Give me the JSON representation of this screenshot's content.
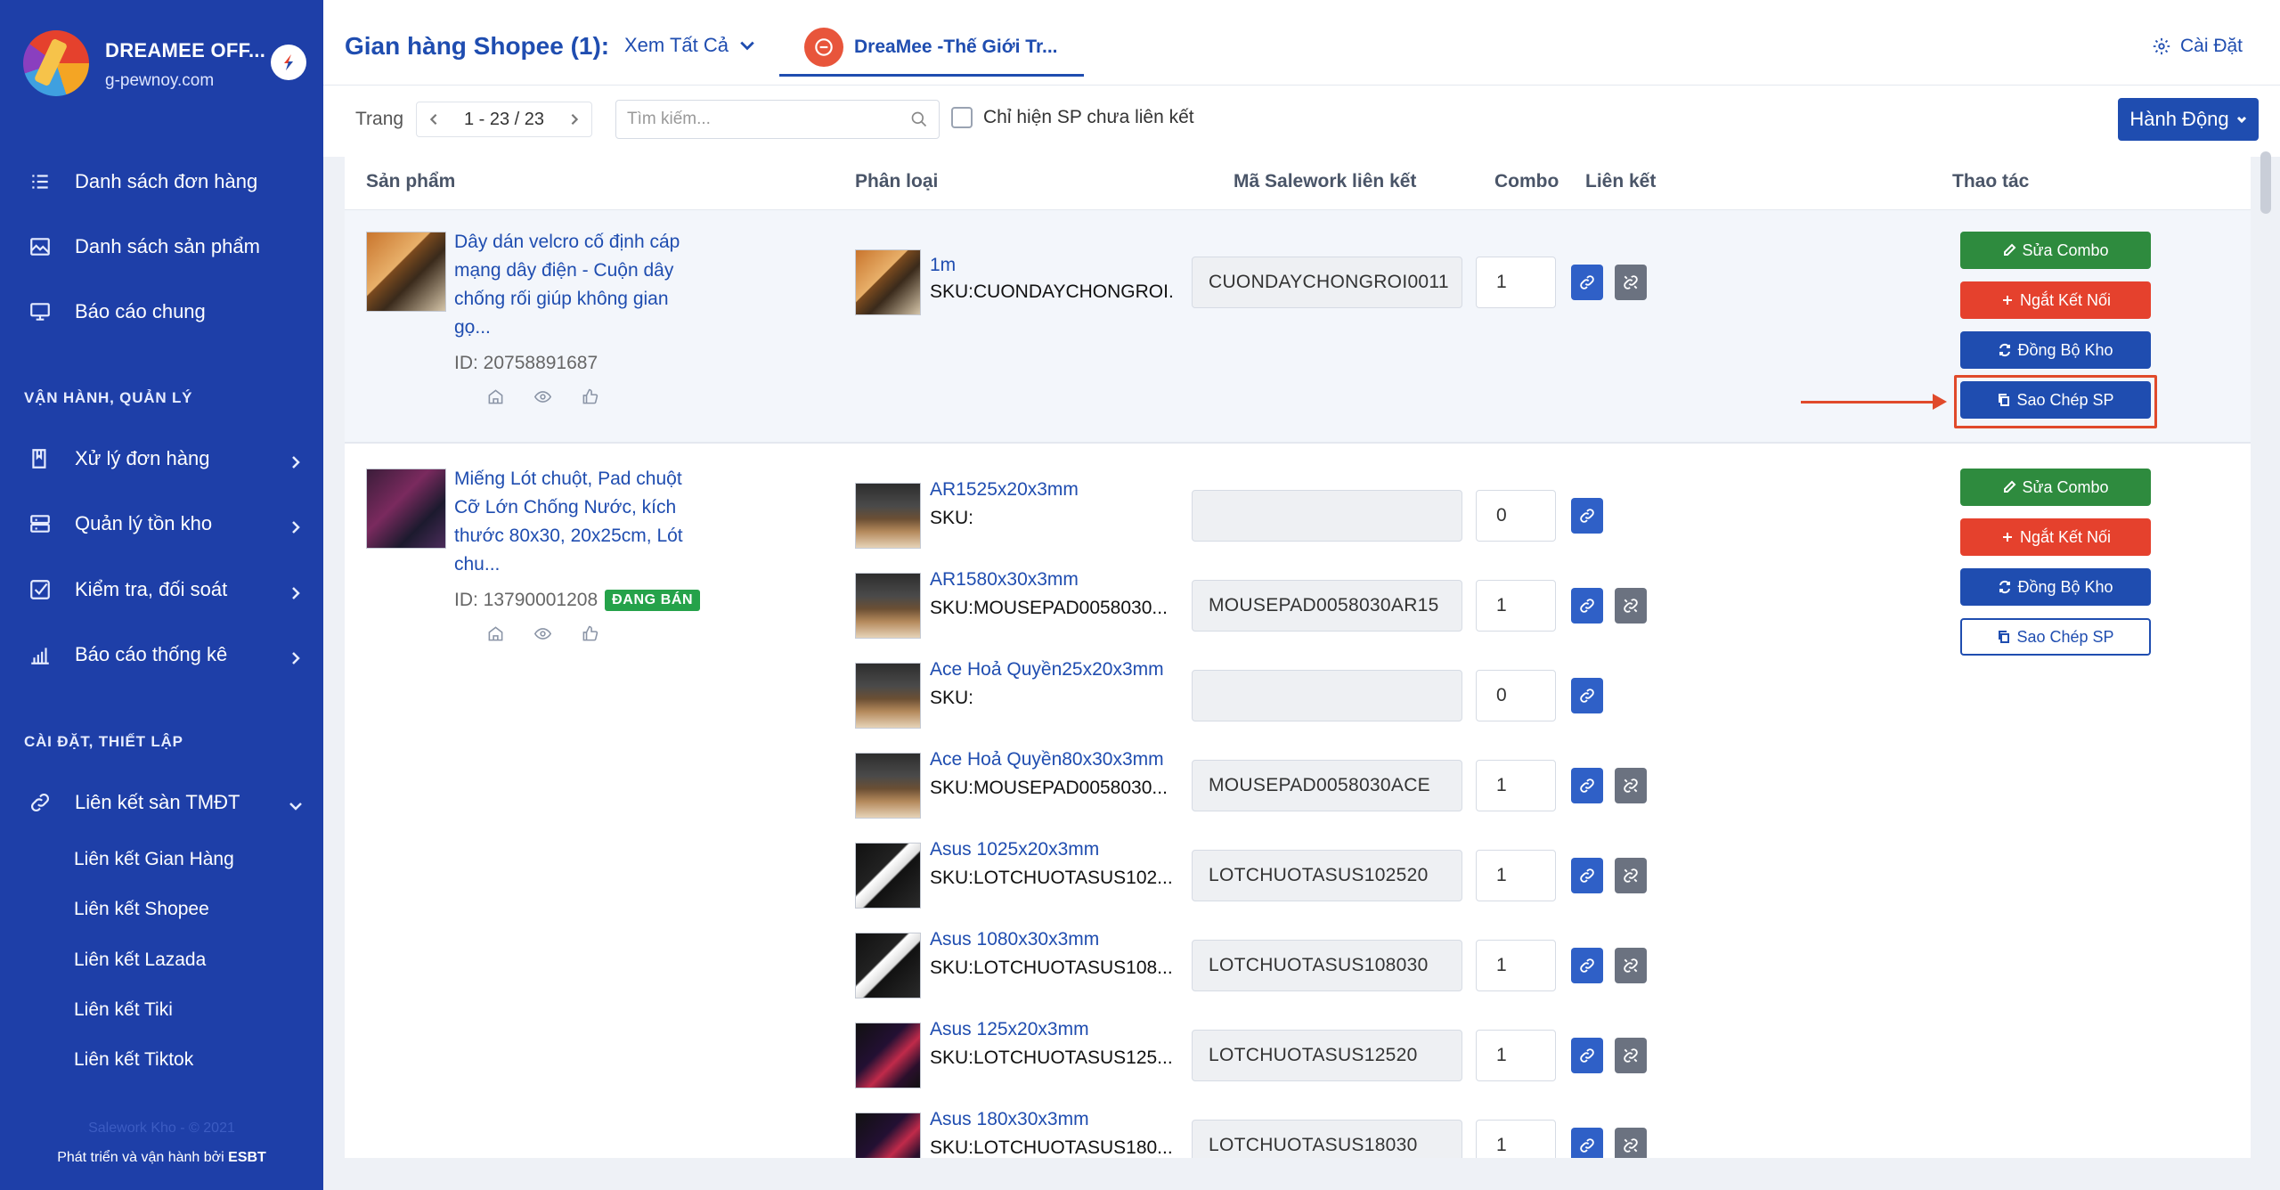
{
  "brand": {
    "name": "DREAMEE OFF...",
    "domain": "g-pewnoy.com"
  },
  "sidebar": {
    "nav": [
      {
        "label": "Danh sách đơn hàng",
        "icon": "list-icon"
      },
      {
        "label": "Danh sách sản phẩm",
        "icon": "image-gallery-icon"
      },
      {
        "label": "Báo cáo chung",
        "icon": "presentation-icon"
      }
    ],
    "section_ops": "VẬN HÀNH, QUẢN LÝ",
    "ops": [
      {
        "label": "Xử lý đơn hàng",
        "icon": "book-icon"
      },
      {
        "label": "Quản lý tồn kho",
        "icon": "warehouse-icon"
      },
      {
        "label": "Kiểm tra, đối soát",
        "icon": "checkbox-icon"
      },
      {
        "label": "Báo cáo thống kê",
        "icon": "bar-chart-icon"
      }
    ],
    "section_settings": "CÀI ĐẶT, THIẾT LẬP",
    "link_group": {
      "label": "Liên kết sàn TMĐT",
      "icon": "link-icon"
    },
    "sub_items": [
      "Liên kết Gian Hàng",
      "Liên kết Shopee",
      "Liên kết Lazada",
      "Liên kết Tiki",
      "Liên kết Tiktok"
    ],
    "footer_faded": "Salework Kho - © 2021",
    "footer_prefix": "Phát triển và vận hành bởi ",
    "footer_company": "ESBT"
  },
  "header": {
    "title": "Gian hàng Shopee (1):",
    "view_all": "Xem Tất Cả",
    "shop_tab": "DreaMee -Thế Giới Tr...",
    "settings": "Cài Đặt"
  },
  "toolbar": {
    "page_label": "Trang",
    "page_range": "1 - 23 / 23",
    "search_placeholder": "Tìm kiếm...",
    "checkbox_label": "Chỉ hiện SP chưa liên kết",
    "action_button": "Hành Động"
  },
  "table": {
    "columns": {
      "product": "Sản phẩm",
      "variant": "Phân loại",
      "sku_link": "Mã Salework liên kết",
      "combo": "Combo",
      "link": "Liên kết",
      "actions": "Thao tác"
    },
    "actions": {
      "edit_combo": "Sửa Combo",
      "disconnect": "Ngắt Kết Nối",
      "sync": "Đồng Bộ Kho",
      "copy": "Sao Chép SP"
    },
    "products": [
      {
        "name": "Dây dán velcro cố định cáp mạng dây điện - Cuộn dây chống rối giúp không gian gọ...",
        "id": "ID: 20758891687",
        "status": "",
        "variants": [
          {
            "name": "1m",
            "sku": "SKU:CUONDAYCHONGROI.",
            "link": "CUONDAYCHONGROI0011",
            "combo": "1"
          }
        ]
      },
      {
        "name": "Miếng Lót chuột, Pad chuột Cỡ Lớn Chống Nước, kích thước 80x30, 20x25cm, Lót chu...",
        "id": "ID: 13790001208",
        "status": "ĐANG BÁN",
        "variants": [
          {
            "name": "AR1525x20x3mm",
            "sku": "SKU:",
            "link": "",
            "combo": "0"
          },
          {
            "name": "AR1580x30x3mm",
            "sku": "SKU:MOUSEPAD0058030...",
            "link": "MOUSEPAD0058030AR15",
            "combo": "1"
          },
          {
            "name": "Ace Hoả Quyền25x20x3mm",
            "sku": "SKU:",
            "link": "",
            "combo": "0"
          },
          {
            "name": "Ace Hoả Quyền80x30x3mm",
            "sku": "SKU:MOUSEPAD0058030...",
            "link": "MOUSEPAD0058030ACE",
            "combo": "1"
          },
          {
            "name": "Asus 1025x20x3mm",
            "sku": "SKU:LOTCHUOTASUS102...",
            "link": "LOTCHUOTASUS102520",
            "combo": "1"
          },
          {
            "name": "Asus 1080x30x3mm",
            "sku": "SKU:LOTCHUOTASUS108...",
            "link": "LOTCHUOTASUS108030",
            "combo": "1"
          },
          {
            "name": "Asus 125x20x3mm",
            "sku": "SKU:LOTCHUOTASUS125...",
            "link": "LOTCHUOTASUS12520",
            "combo": "1"
          },
          {
            "name": "Asus 180x30x3mm",
            "sku": "SKU:LOTCHUOTASUS180...",
            "link": "LOTCHUOTASUS18030",
            "combo": "1"
          }
        ]
      }
    ]
  },
  "colors": {
    "sidebar": "#1e3fa8",
    "primary": "#1f4db0",
    "green": "#2e8b3e",
    "red": "#e5412d",
    "highlight": "#e04a2b"
  }
}
